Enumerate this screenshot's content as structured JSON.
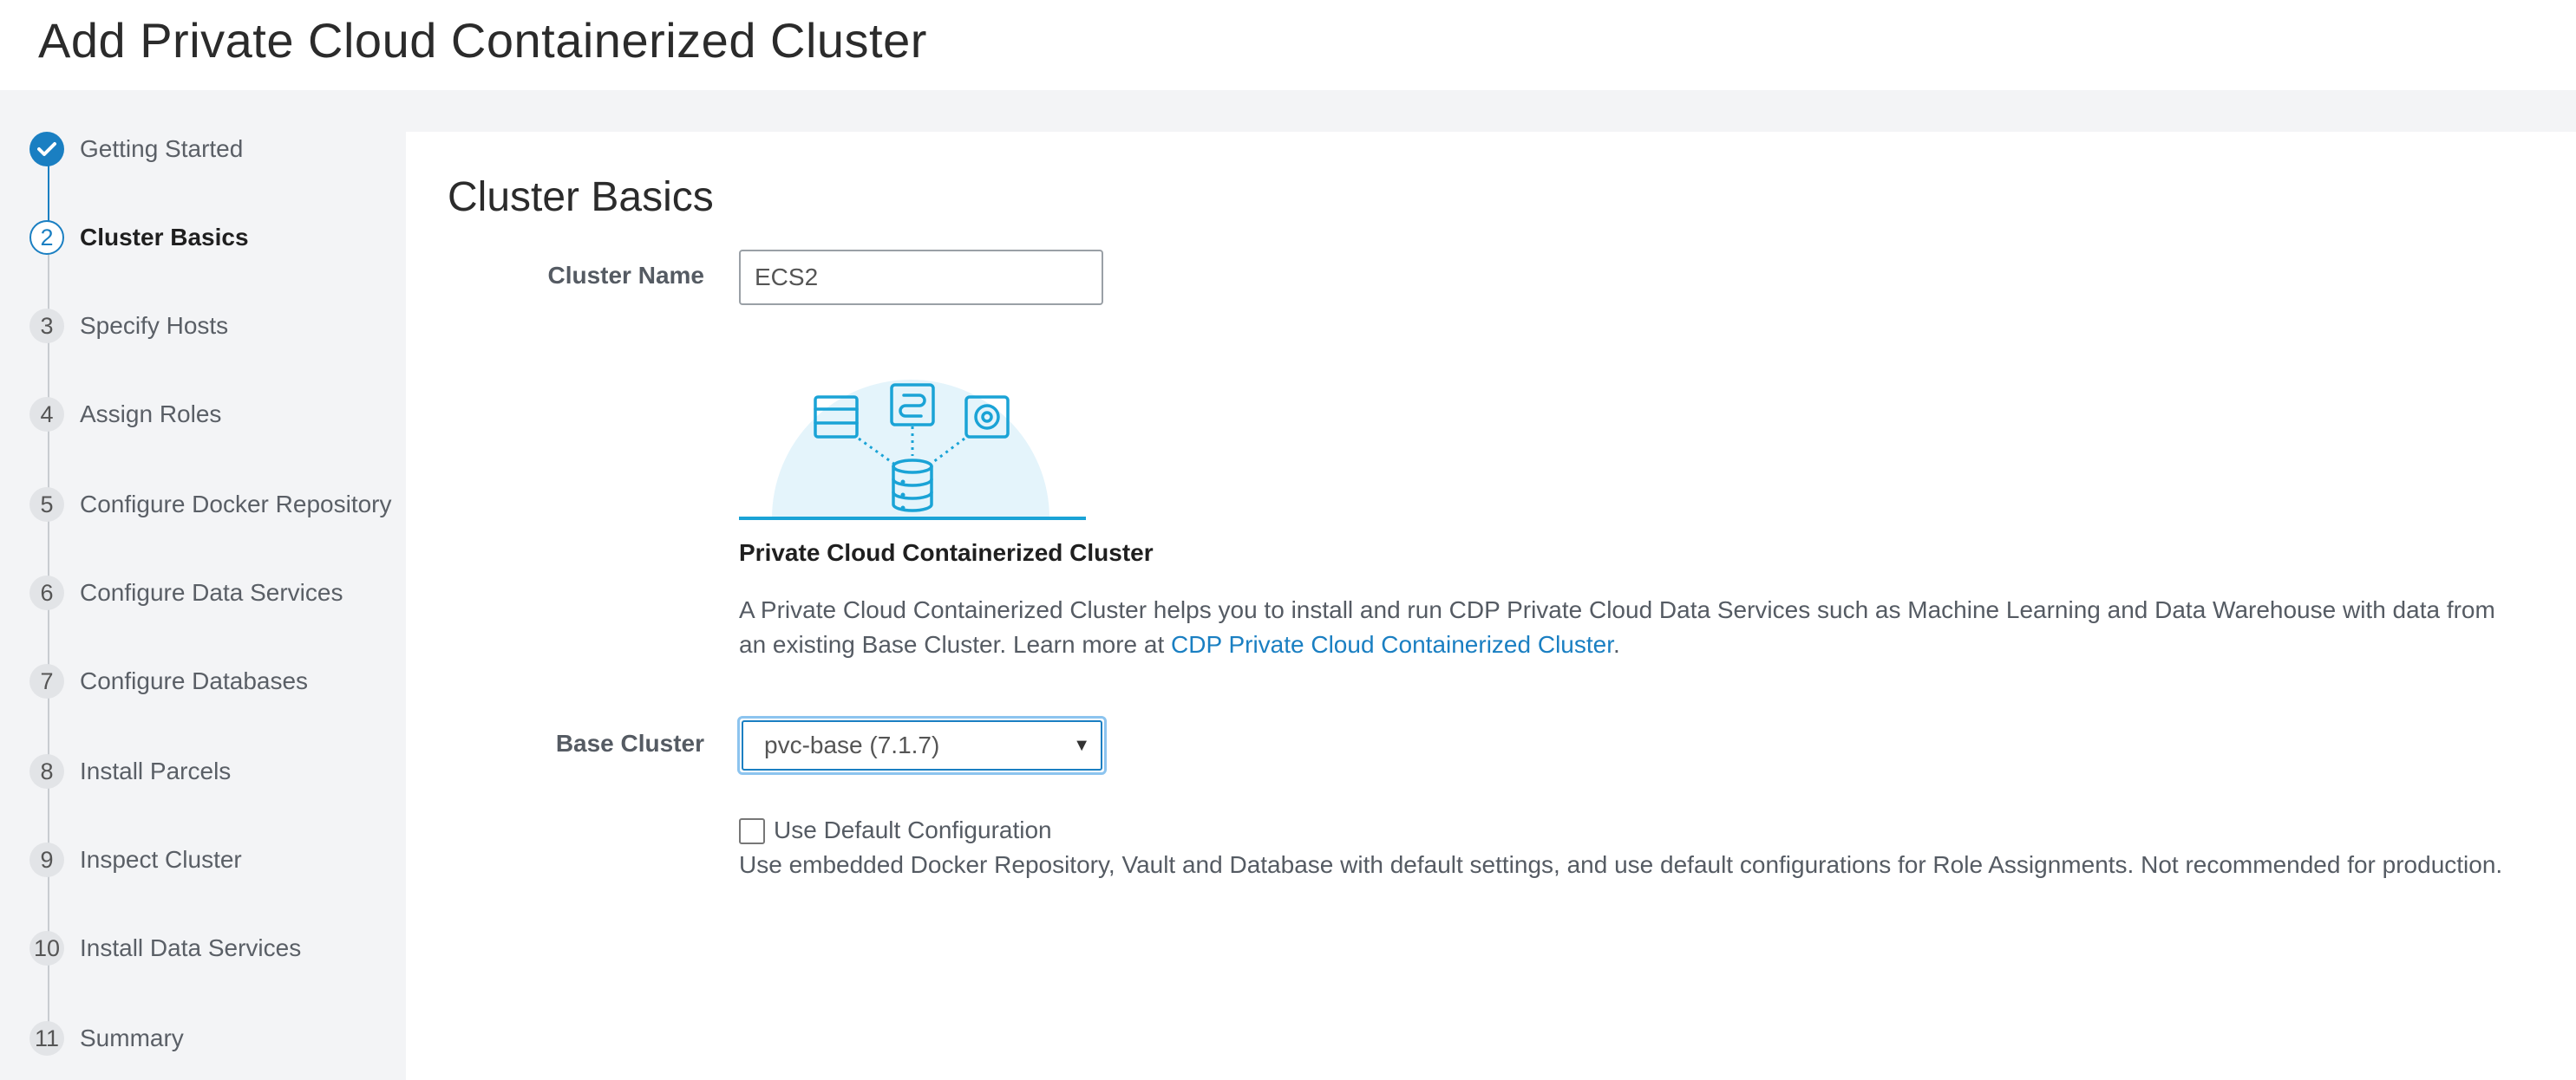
{
  "page_title": "Add Private Cloud Containerized Cluster",
  "steps": [
    {
      "num": "",
      "label": "Getting Started",
      "state": "done"
    },
    {
      "num": "2",
      "label": "Cluster Basics",
      "state": "current"
    },
    {
      "num": "3",
      "label": "Specify Hosts",
      "state": "pending"
    },
    {
      "num": "4",
      "label": "Assign Roles",
      "state": "pending"
    },
    {
      "num": "5",
      "label": "Configure Docker Repository",
      "state": "pending"
    },
    {
      "num": "6",
      "label": "Configure Data Services",
      "state": "pending"
    },
    {
      "num": "7",
      "label": "Configure Databases",
      "state": "pending"
    },
    {
      "num": "8",
      "label": "Install Parcels",
      "state": "pending"
    },
    {
      "num": "9",
      "label": "Inspect Cluster",
      "state": "pending"
    },
    {
      "num": "10",
      "label": "Install Data Services",
      "state": "pending"
    },
    {
      "num": "11",
      "label": "Summary",
      "state": "pending"
    }
  ],
  "main": {
    "section_title": "Cluster Basics",
    "cluster_name_label": "Cluster Name",
    "cluster_name_value": "ECS2",
    "illustration_icon": "cluster-services-illustration",
    "desc_title": "Private Cloud Containerized Cluster",
    "desc_text": "A Private Cloud Containerized Cluster helps you to install and run CDP Private Cloud Data Services such as Machine Learning and Data Warehouse with data from an existing Base Cluster. Learn more at ",
    "desc_link": "CDP Private Cloud Containerized Cluster",
    "desc_suffix": ".",
    "base_cluster_label": "Base Cluster",
    "base_cluster_value": "pvc-base (7.1.7)",
    "checkbox_label": "Use Default Configuration",
    "checkbox_checked": false,
    "help_text": "Use embedded Docker Repository, Vault and Database with default settings, and use default configurations for Role Assignments. Not recommended for production."
  },
  "colors": {
    "accent": "#1a7fc2",
    "sidebar_bg": "#f3f4f6",
    "illustration_bg": "#e4f4fb"
  }
}
